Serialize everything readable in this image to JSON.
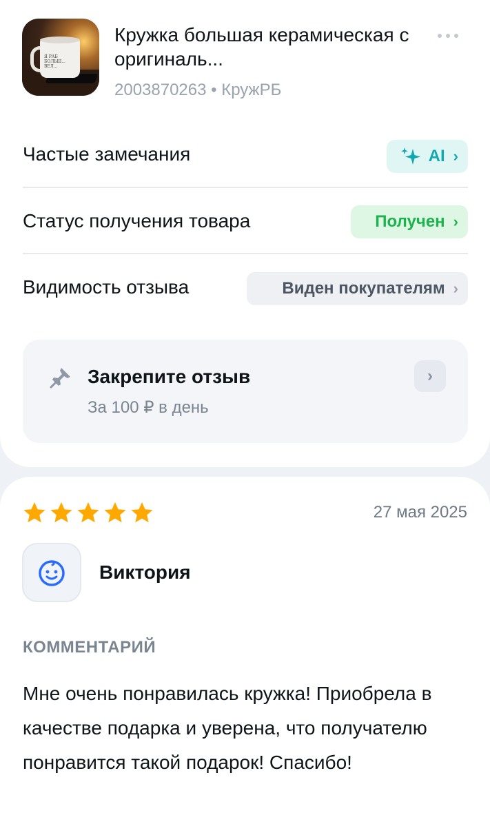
{
  "product": {
    "title": "Кружка большая керамическая с оригиналь...",
    "subtitle": "2003870263 • КружРБ",
    "thumbnail_icon": "mug-photo",
    "thumbnail_text": "Я РАБ БОЛЬШ... ВЕЛ..."
  },
  "rows": [
    {
      "label": "Частые замечания",
      "pill": "AI",
      "pill_icon": "sparkle-icon"
    },
    {
      "label": "Статус получения товара",
      "pill": "Получен"
    },
    {
      "label": "Видимость отзыва",
      "pill": "Виден покупателям"
    }
  ],
  "chevron": "›",
  "pin": {
    "title": "Закрепите отзыв",
    "subtitle": "За 100 ₽ в день",
    "icon": "pin-icon"
  },
  "review": {
    "rating": 5,
    "max_rating": 5,
    "date": "27 мая 2025",
    "author": "Виктория",
    "avatar_icon": "smiley-face-icon",
    "comment_heading": "КОММЕНТАРИЙ",
    "comment": "Мне очень понравилась кружка! Приобрела в качестве подарка и уверена, что получателю понравится такой подарок! Спасибо!"
  },
  "colors": {
    "ai_accent": "#13a7b0",
    "ai_bg": "#dff6f5",
    "received_accent": "#1db24e",
    "received_bg": "#def7e4",
    "star": "#ffa800",
    "avatar_accent": "#2a6bff"
  }
}
